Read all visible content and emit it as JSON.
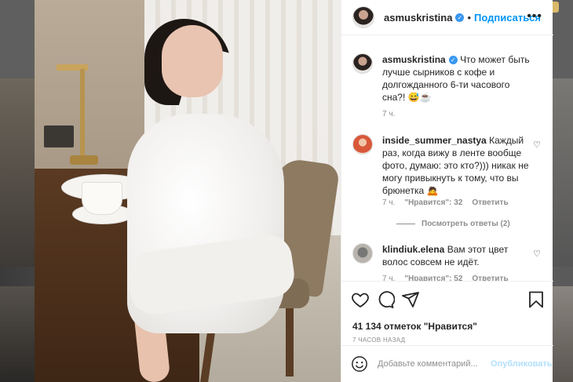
{
  "post": {
    "author": "asmuskristina",
    "follow_label": "Подписаться",
    "more_icon": "more-icon",
    "verified_icon": "verified-badge-icon",
    "colors": {
      "link": "#0095f6",
      "verified": "#3897f0",
      "muted": "#8e8e8e",
      "publish_disabled": "#b2dffc"
    }
  },
  "caption": {
    "author": "asmuskristina",
    "text": "Что может быть лучше сырников с кофе и долгожданного 6-ти часового сна?! 😅☕",
    "time": "7 ч."
  },
  "comments": [
    {
      "author": "inside_summer_nastya",
      "text": "Каждый раз, когда вижу в ленте вообще фото, думаю: это кто?))) никак не могу привыкнуть к тому, что вы брюнетка 🙇",
      "time": "7 ч.",
      "likes": "\"Нравится\": 32",
      "reply_label": "Ответить",
      "view_replies": "Посмотреть ответы (2)"
    },
    {
      "author": "klindiuk.elena",
      "text": "Вам этот цвет волос совсем не идёт.",
      "time": "7 ч.",
      "likes": "\"Нравится\": 52",
      "reply_label": "Ответить"
    }
  ],
  "actions": {
    "like_icon": "heart-icon",
    "comment_icon": "comment-icon",
    "share_icon": "share-icon",
    "save_icon": "bookmark-icon"
  },
  "likes_text": "41 134 отметок \"Нравится\"",
  "posted_ago": "7 ЧАСОВ НАЗАД",
  "comment_box": {
    "emoji_icon": "emoji-icon",
    "placeholder": "Добавьте комментарий...",
    "publish_label": "Опубликовать"
  }
}
